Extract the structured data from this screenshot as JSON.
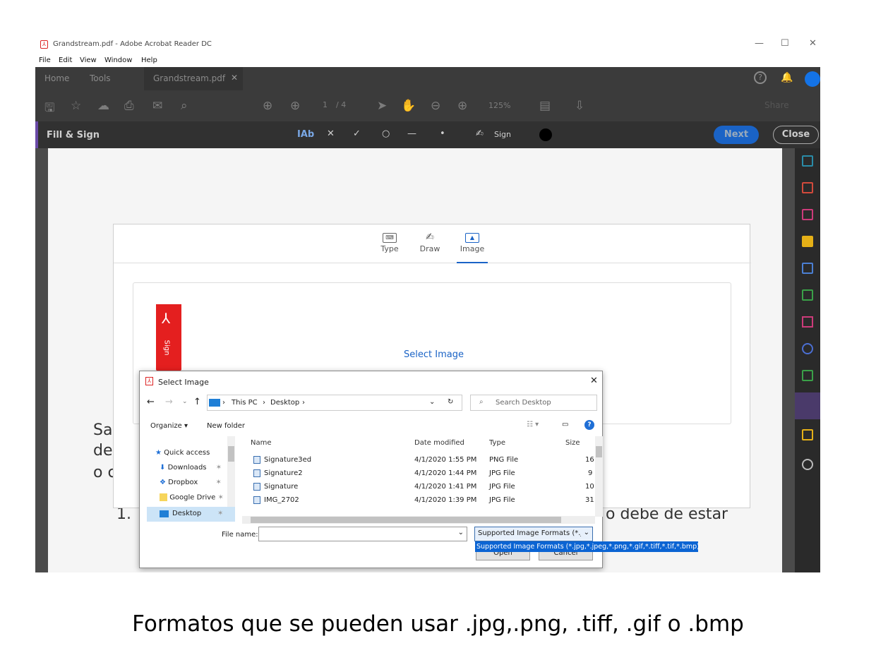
{
  "window": {
    "title": "Grandstream.pdf - Adobe Acrobat Reader DC",
    "controls": [
      "—",
      "☐",
      "✕"
    ]
  },
  "menu": [
    "File",
    "Edit",
    "View",
    "Window",
    "Help"
  ],
  "tabs": {
    "home": "Home",
    "tools": "Tools",
    "doc": "Grandstream.pdf"
  },
  "toolbar": {
    "page_current": "1",
    "page_total": "/ 4",
    "zoom": "125%",
    "share": "Share"
  },
  "fillsign": {
    "title": "Fill & Sign",
    "text_tool": "IAb",
    "sign_label": "Sign",
    "next": "Next",
    "close": "Close"
  },
  "document_text": {
    "left1": "Sa",
    "left2": "de",
    "left3": "o c",
    "item_num": "1.",
    "right_line": "o debe de estar"
  },
  "signature_panel": {
    "tabs": [
      {
        "label": "Type",
        "icon": "keyboard-icon"
      },
      {
        "label": "Draw",
        "icon": "pen-icon"
      },
      {
        "label": "Image",
        "icon": "image-icon"
      }
    ],
    "select_image": "Select Image",
    "flag_label": "Sign"
  },
  "dialog": {
    "title": "Select Image",
    "breadcrumb": [
      "This PC",
      "Desktop"
    ],
    "search_placeholder": "Search Desktop",
    "organize": "Organize ▾",
    "new_folder": "New folder",
    "nav_items": [
      {
        "label": "Quick access",
        "icon": "star-icon"
      },
      {
        "label": "Downloads",
        "icon": "download-icon"
      },
      {
        "label": "Dropbox",
        "icon": "dropbox-icon"
      },
      {
        "label": "Google Drive",
        "icon": "folder-icon"
      },
      {
        "label": "Desktop",
        "icon": "desktop-icon"
      }
    ],
    "columns": {
      "name": "Name",
      "date": "Date modified",
      "type": "Type",
      "size": "Size"
    },
    "files": [
      {
        "name": "Signature3ed",
        "date": "4/1/2020 1:55 PM",
        "type": "PNG File",
        "size": "16"
      },
      {
        "name": "Signature2",
        "date": "4/1/2020 1:44 PM",
        "type": "JPG File",
        "size": "9"
      },
      {
        "name": "Signature",
        "date": "4/1/2020 1:41 PM",
        "type": "JPG File",
        "size": "10"
      },
      {
        "name": "IMG_2702",
        "date": "4/1/2020 1:39 PM",
        "type": "JPG File",
        "size": "31"
      }
    ],
    "file_name_label": "File name:",
    "file_name_value": "",
    "format_selected": "Supported Image Formats (*.jp",
    "format_option": "Supported Image Formats (*.jpg,*.jpeg,*.png,*.gif,*.tiff,*.tif,*.bmp)",
    "open": "Open",
    "cancel": "Cancel"
  },
  "caption": "Formatos que se pueden usar .jpg,.png, .tiff, .gif o .bmp"
}
